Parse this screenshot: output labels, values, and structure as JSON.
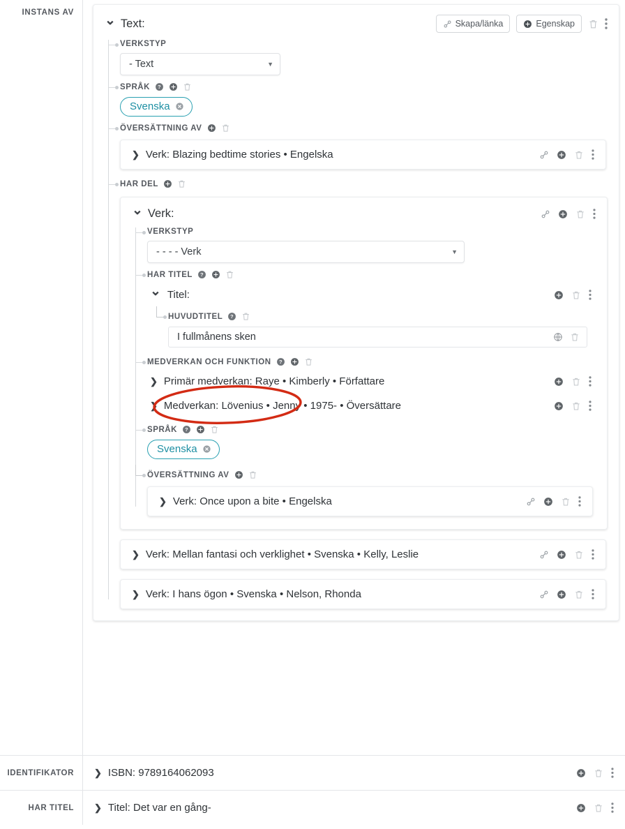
{
  "sidebar": {
    "instance_of_label": "INSTANS AV",
    "identifier_label": "IDENTIFIKATOR",
    "has_title_label": "HAR TITEL"
  },
  "main_card": {
    "title": "Text:",
    "actions": {
      "create_link_label": "Skapa/länka",
      "property_label": "Egenskap",
      "link_icon": "link-icon",
      "plus_icon": "plus-circle-icon",
      "trash_icon": "trash-icon",
      "kebab_icon": "kebab-menu-icon"
    },
    "fields": {
      "worktype_label": "VERKSTYP",
      "worktype_value": "- Text",
      "language_label": "SPRÅK",
      "language_chip": "Svenska",
      "translation_of_label": "ÖVERSÄTTNING AV",
      "translation_of_row": "Verk: Blazing bedtime stories • Engelska",
      "has_part_label": "HAR DEL"
    }
  },
  "inner_work": {
    "title": "Verk:",
    "worktype_label": "VERKSTYP",
    "worktype_value": "- - - - Verk",
    "has_title_label": "HAR TITEL",
    "title_card_label": "Titel:",
    "main_title_label": "HUVUDTITEL",
    "main_title_value": "I fullmånens sken",
    "contribution_label": "MEDVERKAN OCH FUNKTION",
    "contributions": [
      "Primär medverkan: Raye • Kimberly • Författare",
      "Medverkan: Lövenius • Jenny • 1975- • Översättare"
    ],
    "language_label": "SPRÅK",
    "language_chip": "Svenska",
    "translation_of_label": "ÖVERSÄTTNING AV",
    "translation_of_row": "Verk: Once upon a bite • Engelska"
  },
  "sibling_works": [
    "Verk: Mellan fantasi och verklighet • Svenska • Kelly, Leslie",
    "Verk: I hans ögon • Svenska • Nelson, Rhonda"
  ],
  "bottom_rows": [
    {
      "gutter": "IDENTIFIKATOR",
      "text": "ISBN: 9789164062093"
    },
    {
      "gutter": "HAR TITEL",
      "text": "Titel: Det var en gång-"
    }
  ],
  "annotation": {
    "shape": "red-ellipse-highlight",
    "color": "#d32b14",
    "targets": "main_title_value"
  },
  "colors": {
    "chip_teal": "#1d8fa3",
    "card_border": "#eceef0",
    "tree_line": "#d6d9dc",
    "label_gray": "#55595f",
    "annotation_red": "#d32b14"
  }
}
